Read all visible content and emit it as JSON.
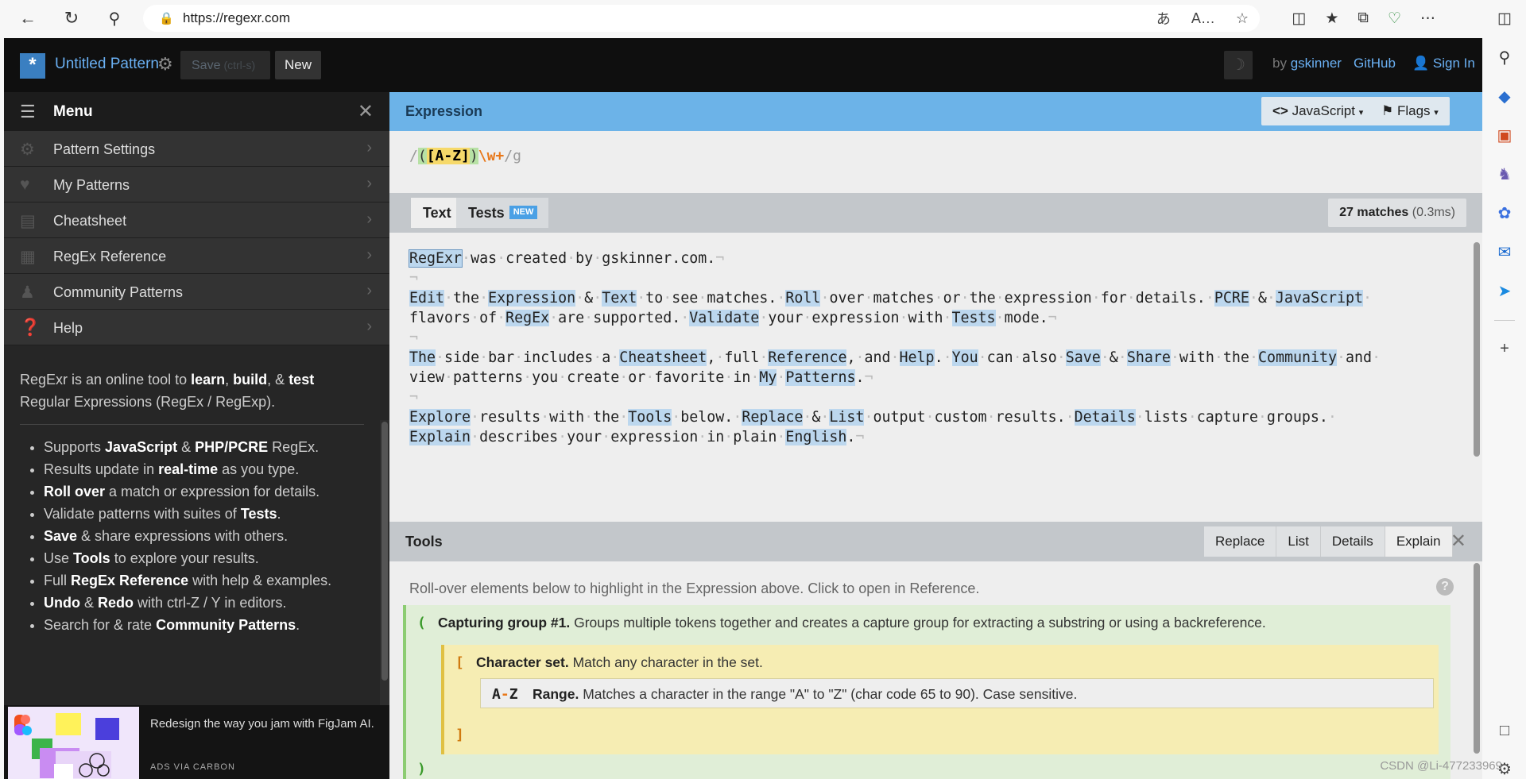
{
  "browser": {
    "url": "https://regexr.com",
    "icons": [
      "back-icon",
      "refresh-icon",
      "search-icon",
      "lock-icon",
      "read-aloud-icon",
      "translate-icon",
      "favorite-icon",
      "split-screen-icon",
      "favorites-icon",
      "collections-icon",
      "health-icon",
      "more-icon"
    ]
  },
  "header": {
    "pattern_title": "Untitled Pattern",
    "save_label": "Save",
    "save_hint": "(ctrl-s)",
    "new_label": "New",
    "by_label": "by",
    "author": "gskinner",
    "github": "GitHub",
    "sign_in": "Sign In"
  },
  "menu": {
    "title": "Menu",
    "items": [
      {
        "label": "Pattern Settings",
        "icon": "gear-icon"
      },
      {
        "label": "My Patterns",
        "icon": "heart-icon"
      },
      {
        "label": "Cheatsheet",
        "icon": "document-icon"
      },
      {
        "label": "RegEx Reference",
        "icon": "book-icon"
      },
      {
        "label": "Community Patterns",
        "icon": "people-icon"
      },
      {
        "label": "Help",
        "icon": "help-icon"
      }
    ]
  },
  "intro": {
    "p1_a": "RegExr is an online tool to ",
    "p1_learn": "learn",
    "p1_b": ", ",
    "p1_build": "build",
    "p1_c": ", & ",
    "p1_test": "test",
    "p1_d": " Regular Expressions (RegEx / RegExp).",
    "bullets": [
      {
        "a": "Supports ",
        "b": "JavaScript",
        "c": " & ",
        "d": "PHP/PCRE",
        "e": " RegEx."
      },
      {
        "a": "Results update in ",
        "b": "real-time",
        "c": " as you type.",
        "d": "",
        "e": ""
      },
      {
        "a": "",
        "b": "Roll over",
        "c": " a match or expression for details.",
        "d": "",
        "e": ""
      },
      {
        "a": "Validate patterns with suites of ",
        "b": "Tests",
        "c": ".",
        "d": "",
        "e": ""
      },
      {
        "a": "",
        "b": "Save",
        "c": " & share expressions with others.",
        "d": "",
        "e": ""
      },
      {
        "a": "Use ",
        "b": "Tools",
        "c": " to explore your results.",
        "d": "",
        "e": ""
      },
      {
        "a": "Full ",
        "b": "RegEx Reference",
        "c": " with help & examples.",
        "d": "",
        "e": ""
      },
      {
        "a": "",
        "b": "Undo",
        "c": " & ",
        "d": "Redo",
        "e": " with ctrl-Z / Y in editors."
      },
      {
        "a": "Search for & rate ",
        "b": "Community Patterns",
        "c": ".",
        "d": "",
        "e": ""
      }
    ]
  },
  "ad": {
    "text": "Redesign the way you jam with FigJam AI.",
    "via": "ADS VIA CARBON"
  },
  "expression": {
    "title": "Expression",
    "flavor": "JavaScript",
    "flags_label": "Flags",
    "open_delim": "/",
    "open_group": "(",
    "set_open": "[",
    "range": "A-Z",
    "set_close": "]",
    "close_group": ")",
    "token": "\\w+",
    "close_delim": "/",
    "flags": "g"
  },
  "text_panel": {
    "tab_text": "Text",
    "tab_tests": "Tests",
    "badge_new": "NEW",
    "match_count": "27 matches",
    "match_time": "(0.3ms)"
  },
  "tools": {
    "title": "Tools",
    "tabs": [
      "Replace",
      "List",
      "Details",
      "Explain"
    ],
    "active_tab": "Explain",
    "hint": "Roll-over elements below to highlight in the Expression above. Click to open in Reference.",
    "group_open": "(",
    "group_close": ")",
    "group_title": "Capturing group #1.",
    "group_desc": " Groups multiple tokens together and creates a capture group for extracting a substring or using a backreference.",
    "set_open": "[",
    "set_close": "]",
    "set_title": "Character set.",
    "set_desc": " Match any character in the set.",
    "range_a": "A",
    "range_dash": "-",
    "range_z": "Z",
    "range_title": "Range.",
    "range_desc": " Matches a character in the range \"A\" to \"Z\" (char code 65 to 90). Case sensitive."
  },
  "watermark": "CSDN @Li-477233969",
  "colors": {
    "accent": "#6cb3e8",
    "link": "#6ab0f3",
    "match_highlight": "#bcd7ee",
    "group_bg": "#e0eed7",
    "set_bg": "#f6edb3"
  }
}
